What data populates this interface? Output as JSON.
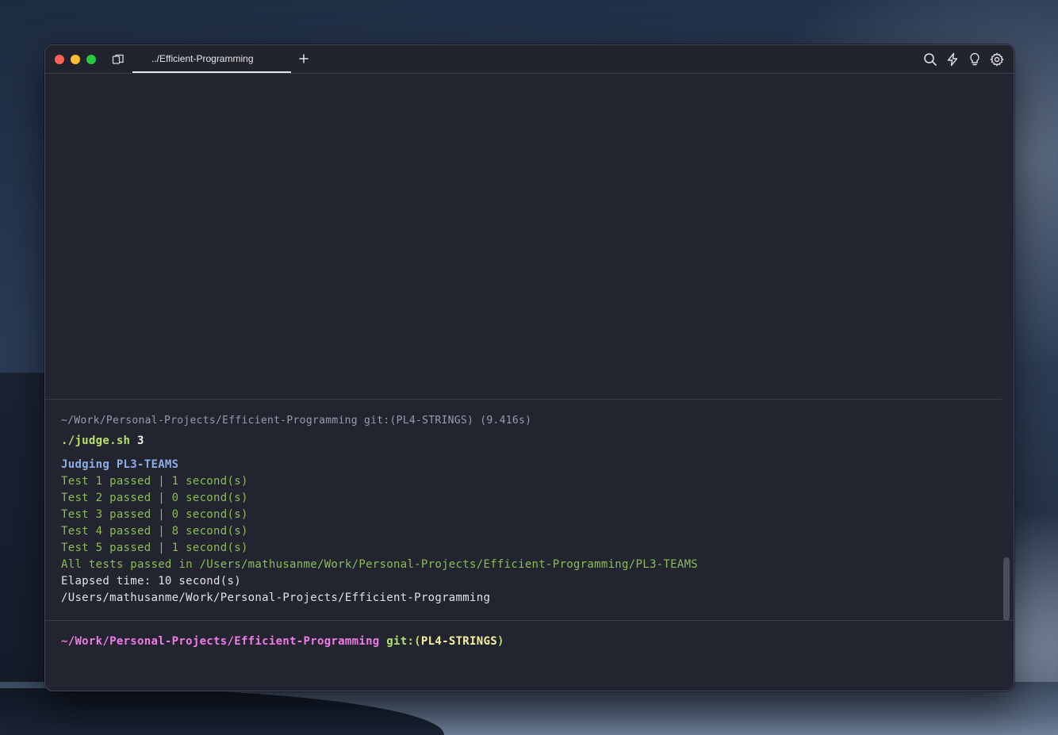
{
  "tab": {
    "label": "../Efficient-Programming"
  },
  "toolbar": {
    "icons": [
      "search-icon",
      "lightning-icon",
      "lightbulb-icon",
      "gear-icon"
    ]
  },
  "previous_block": {
    "header": "~/Work/Personal-Projects/Efficient-Programming git:(PL4-STRINGS) (9.416s)",
    "command": "./judge.sh",
    "argument": "3",
    "output": {
      "judging": "Judging PL3-TEAMS",
      "tests": [
        "Test 1 passed | 1 second(s)",
        "Test 2 passed | 0 second(s)",
        "Test 3 passed | 0 second(s)",
        "Test 4 passed | 8 second(s)",
        "Test 5 passed | 1 second(s)"
      ],
      "summary": "All tests passed in /Users/mathusanme/Work/Personal-Projects/Efficient-Programming/PL3-TEAMS",
      "elapsed": "Elapsed time: 10 second(s)",
      "cwd": "/Users/mathusanme/Work/Personal-Projects/Efficient-Programming"
    }
  },
  "prompt": {
    "path": "~/Work/Personal-Projects/Efficient-Programming",
    "git_prefix": "git:(",
    "branch": "PL4-STRINGS",
    "git_suffix": ")"
  },
  "colors": {
    "traffic_close": "#ff5f57",
    "traffic_minimize": "#febc2e",
    "traffic_maximize": "#28c840",
    "prompt_path": "#ef7be6",
    "command": "#b6e06a",
    "passed": "#8cbd55",
    "judging": "#8caee6"
  }
}
